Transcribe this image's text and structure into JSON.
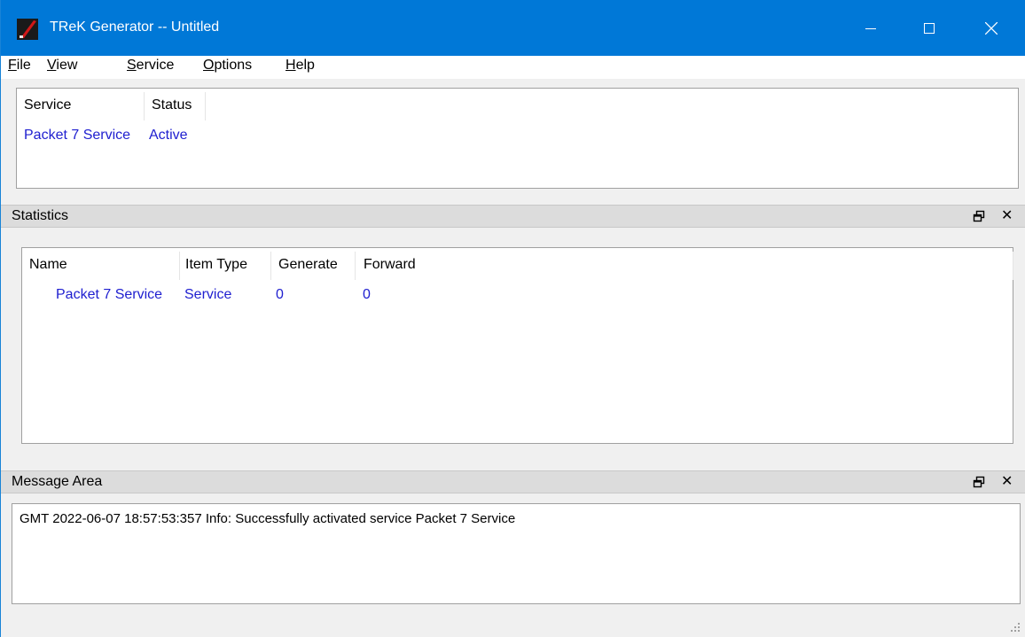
{
  "window": {
    "title": "TReK Generator -- Untitled"
  },
  "menu": {
    "file": {
      "first": "F",
      "rest": "ile"
    },
    "view": {
      "first": "V",
      "rest": "iew"
    },
    "service": {
      "first": "S",
      "rest": "ervice"
    },
    "options": {
      "first": "O",
      "rest": "ptions"
    },
    "help": {
      "first": "H",
      "rest": "elp"
    }
  },
  "services": {
    "headers": {
      "service": "Service",
      "status": "Status"
    },
    "rows": [
      {
        "service": "Packet 7 Service",
        "status": "Active"
      }
    ]
  },
  "statistics": {
    "title": "Statistics",
    "headers": {
      "name": "Name",
      "item_type": "Item Type",
      "generate": "Generate",
      "forward": "Forward"
    },
    "rows": [
      {
        "name": "Packet 7 Service",
        "item_type": "Service",
        "generate": "0",
        "forward": "0"
      }
    ]
  },
  "message_area": {
    "title": "Message Area",
    "messages": [
      "GMT 2022-06-07 18:57:53:357  Info:  Successfully activated service Packet 7 Service"
    ]
  },
  "colors": {
    "titlebar": "#0078d7",
    "link_text": "#2020d0"
  }
}
